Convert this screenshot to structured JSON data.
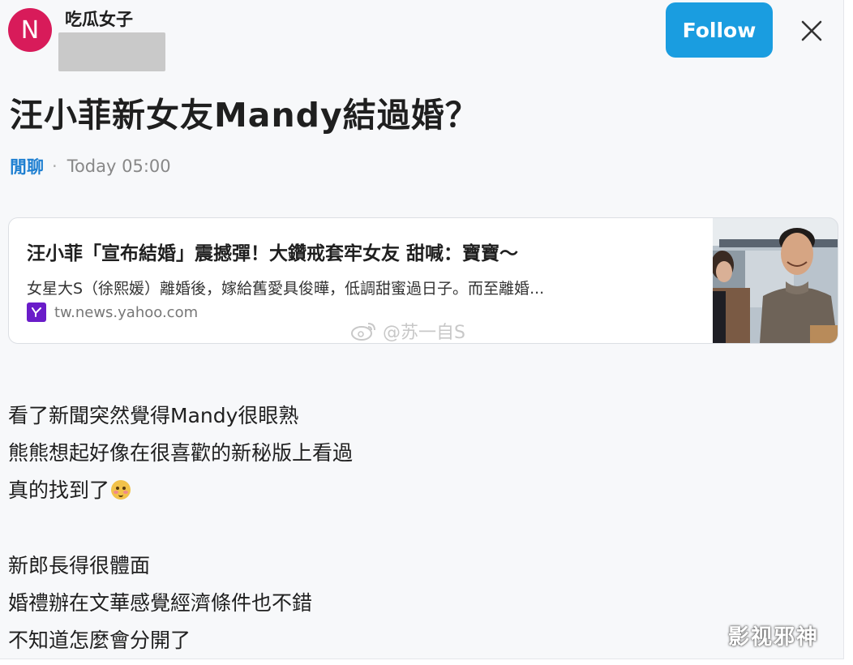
{
  "author": {
    "avatar_letter": "N",
    "name": "吃瓜女子",
    "avatar_color": "#d81b5a"
  },
  "header": {
    "follow_label": "Follow",
    "close_icon": "close-icon",
    "accent": "#1a9de0"
  },
  "post": {
    "title": "汪小菲新女友Mandy結過婚？",
    "category": "閒聊",
    "separator": "·",
    "timestamp": "Today 05:00"
  },
  "link_card": {
    "title": "汪小菲「宣布結婚」震撼彈！大鑽戒套牢女友 甜喊：寶寶～",
    "description": "女星大S（徐熙媛）離婚後，嫁給舊愛具俊曄，低調甜蜜過日子。而至離婚...",
    "source": "tw.news.yahoo.com",
    "source_icon": "yahoo-icon"
  },
  "body": {
    "lines": [
      "看了新聞突然覺得Mandy很眼熟",
      "熊熊想起好像在很喜歡的新秘版上看過",
      "真的找到了"
    ],
    "emoji": "flushed-face-emoji",
    "lines2": [
      "新郎長得很體面",
      "婚禮辦在文華感覺經濟條件也不錯",
      "不知道怎麼會分開了"
    ]
  },
  "watermarks": {
    "mid": "@苏一自S",
    "corner": "影视邪神"
  }
}
